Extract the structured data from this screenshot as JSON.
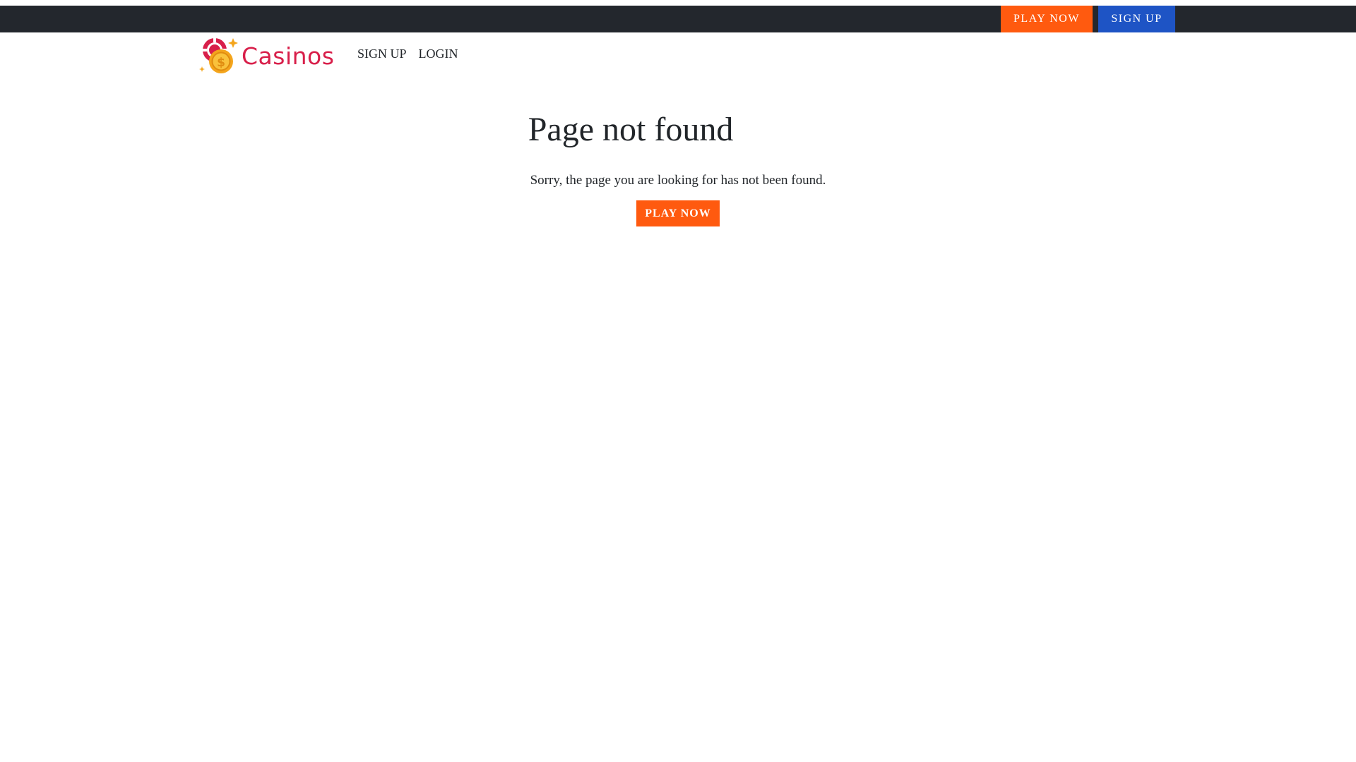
{
  "topbar": {
    "play_now_label": "PLAY NOW",
    "sign_up_label": "SIGN UP",
    "background_color": "#23272d",
    "play_color": "#ff5a0f",
    "signup_color": "#1e54c5"
  },
  "header": {
    "logo_text": "Casinos",
    "logo_icon": "coin-chip-icon",
    "nav": {
      "sign_up_label": "SIGN UP",
      "login_label": "LOGIN"
    }
  },
  "main": {
    "title": "Page not found",
    "message": "Sorry, the page you are looking for has not been found.",
    "cta_label": "PLAY NOW",
    "cta_color": "#ff5a0f"
  }
}
